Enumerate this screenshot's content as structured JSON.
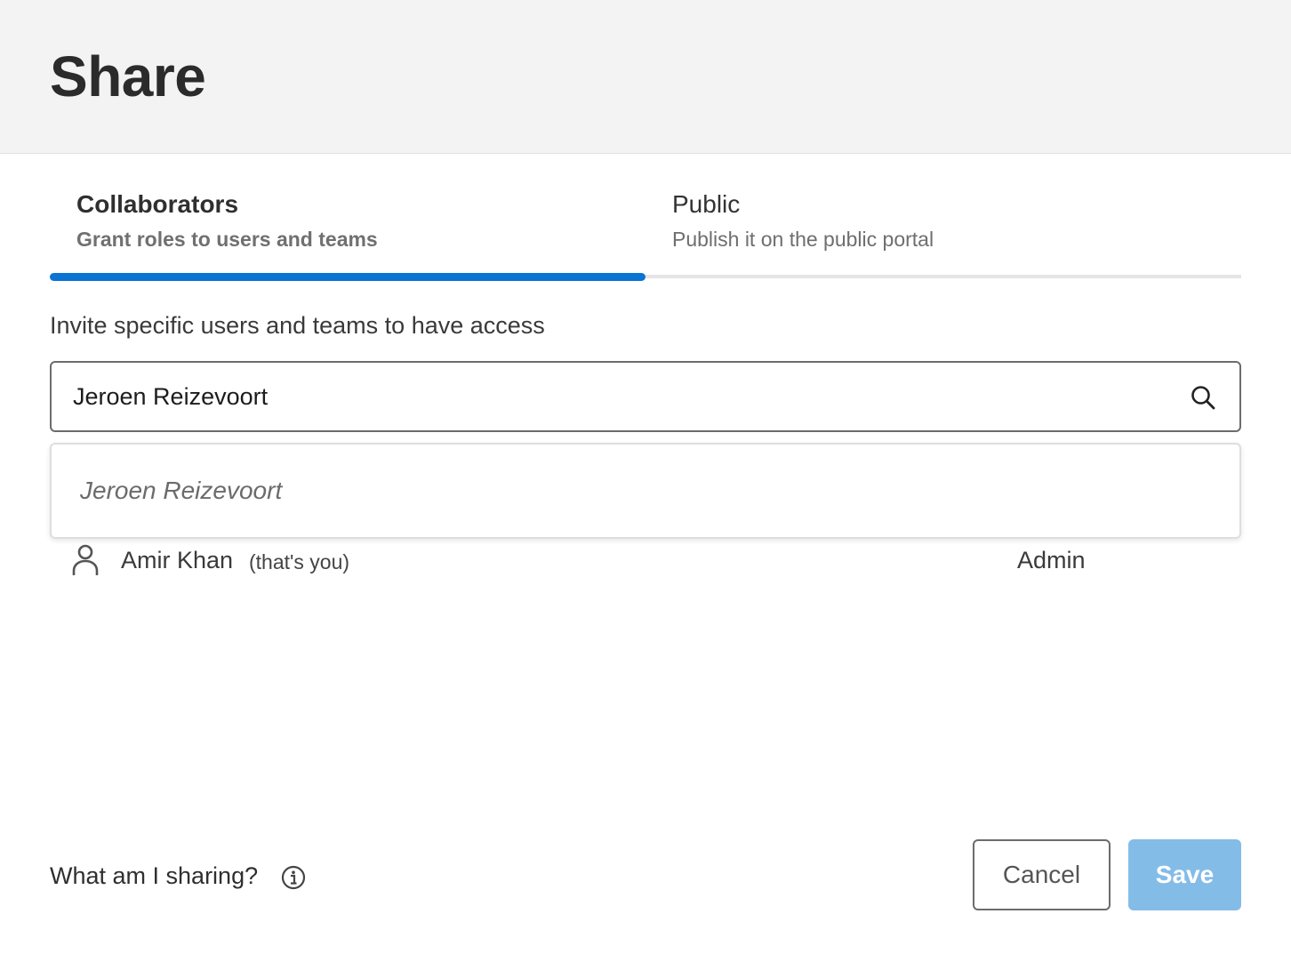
{
  "dialog": {
    "title": "Share"
  },
  "tabs": [
    {
      "label": "Collaborators",
      "subtitle": "Grant roles to users and teams",
      "active": true
    },
    {
      "label": "Public",
      "subtitle": "Publish it on the public portal",
      "active": false
    }
  ],
  "invite": {
    "label": "Invite specific users and teams to have access",
    "search_value": "Jeroen Reizevoort",
    "suggestion": "Jeroen Reizevoort"
  },
  "collaborators": [
    {
      "name": "Amir Khan",
      "note": "(that's you)",
      "role": "Admin"
    }
  ],
  "footer": {
    "help_text": "What am I sharing?",
    "cancel_label": "Cancel",
    "save_label": "Save"
  },
  "colors": {
    "accent": "#0a74d4",
    "save_disabled": "#84bce8",
    "header_bg": "#f3f3f3"
  },
  "icons": {
    "search": "search-icon",
    "person": "person-icon",
    "info": "info-icon"
  }
}
